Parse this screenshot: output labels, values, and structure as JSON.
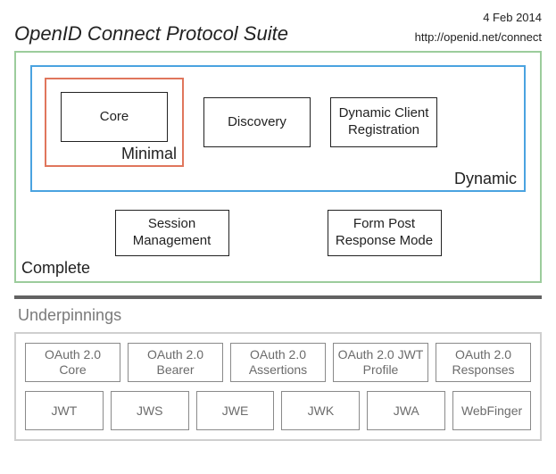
{
  "header": {
    "title": "OpenID Connect Protocol Suite",
    "date": "4 Feb 2014",
    "url": "http://openid.net/connect"
  },
  "labels": {
    "complete": "Complete",
    "dynamic": "Dynamic",
    "minimal": "Minimal"
  },
  "specs": {
    "core": "Core",
    "discovery": "Discovery",
    "dcr": "Dynamic Client Registration",
    "session": "Session Management",
    "formpost": "Form Post Response Mode"
  },
  "underpinnings": {
    "title": "Underpinnings",
    "row1": [
      "OAuth 2.0 Core",
      "OAuth 2.0 Bearer",
      "OAuth 2.0 Assertions",
      "OAuth 2.0 JWT Profile",
      "OAuth 2.0 Responses"
    ],
    "row2": [
      "JWT",
      "JWS",
      "JWE",
      "JWK",
      "JWA",
      "WebFinger"
    ]
  }
}
